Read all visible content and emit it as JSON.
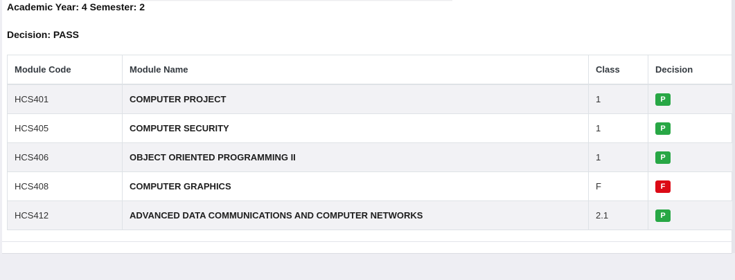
{
  "header": {
    "academic_line": "Academic Year: 4 Semester: 2",
    "decision_line": "Decision: PASS"
  },
  "table": {
    "columns": [
      "Module Code",
      "Module Name",
      "Class",
      "Decision"
    ],
    "rows": [
      {
        "code": "HCS401",
        "name": "COMPUTER PROJECT",
        "class": "1",
        "decision": "P",
        "status": "pass"
      },
      {
        "code": "HCS405",
        "name": "COMPUTER SECURITY",
        "class": "1",
        "decision": "P",
        "status": "pass"
      },
      {
        "code": "HCS406",
        "name": "OBJECT ORIENTED PROGRAMMING II",
        "class": "1",
        "decision": "P",
        "status": "pass"
      },
      {
        "code": "HCS408",
        "name": "COMPUTER GRAPHICS",
        "class": "F",
        "decision": "F",
        "status": "fail"
      },
      {
        "code": "HCS412",
        "name": "ADVANCED DATA COMMUNICATIONS AND COMPUTER NETWORKS",
        "class": "2.1",
        "decision": "P",
        "status": "pass"
      }
    ]
  },
  "colors": {
    "pass_badge": "#28a745",
    "fail_badge": "#dc0a16",
    "page_background": "#eeeef3"
  }
}
